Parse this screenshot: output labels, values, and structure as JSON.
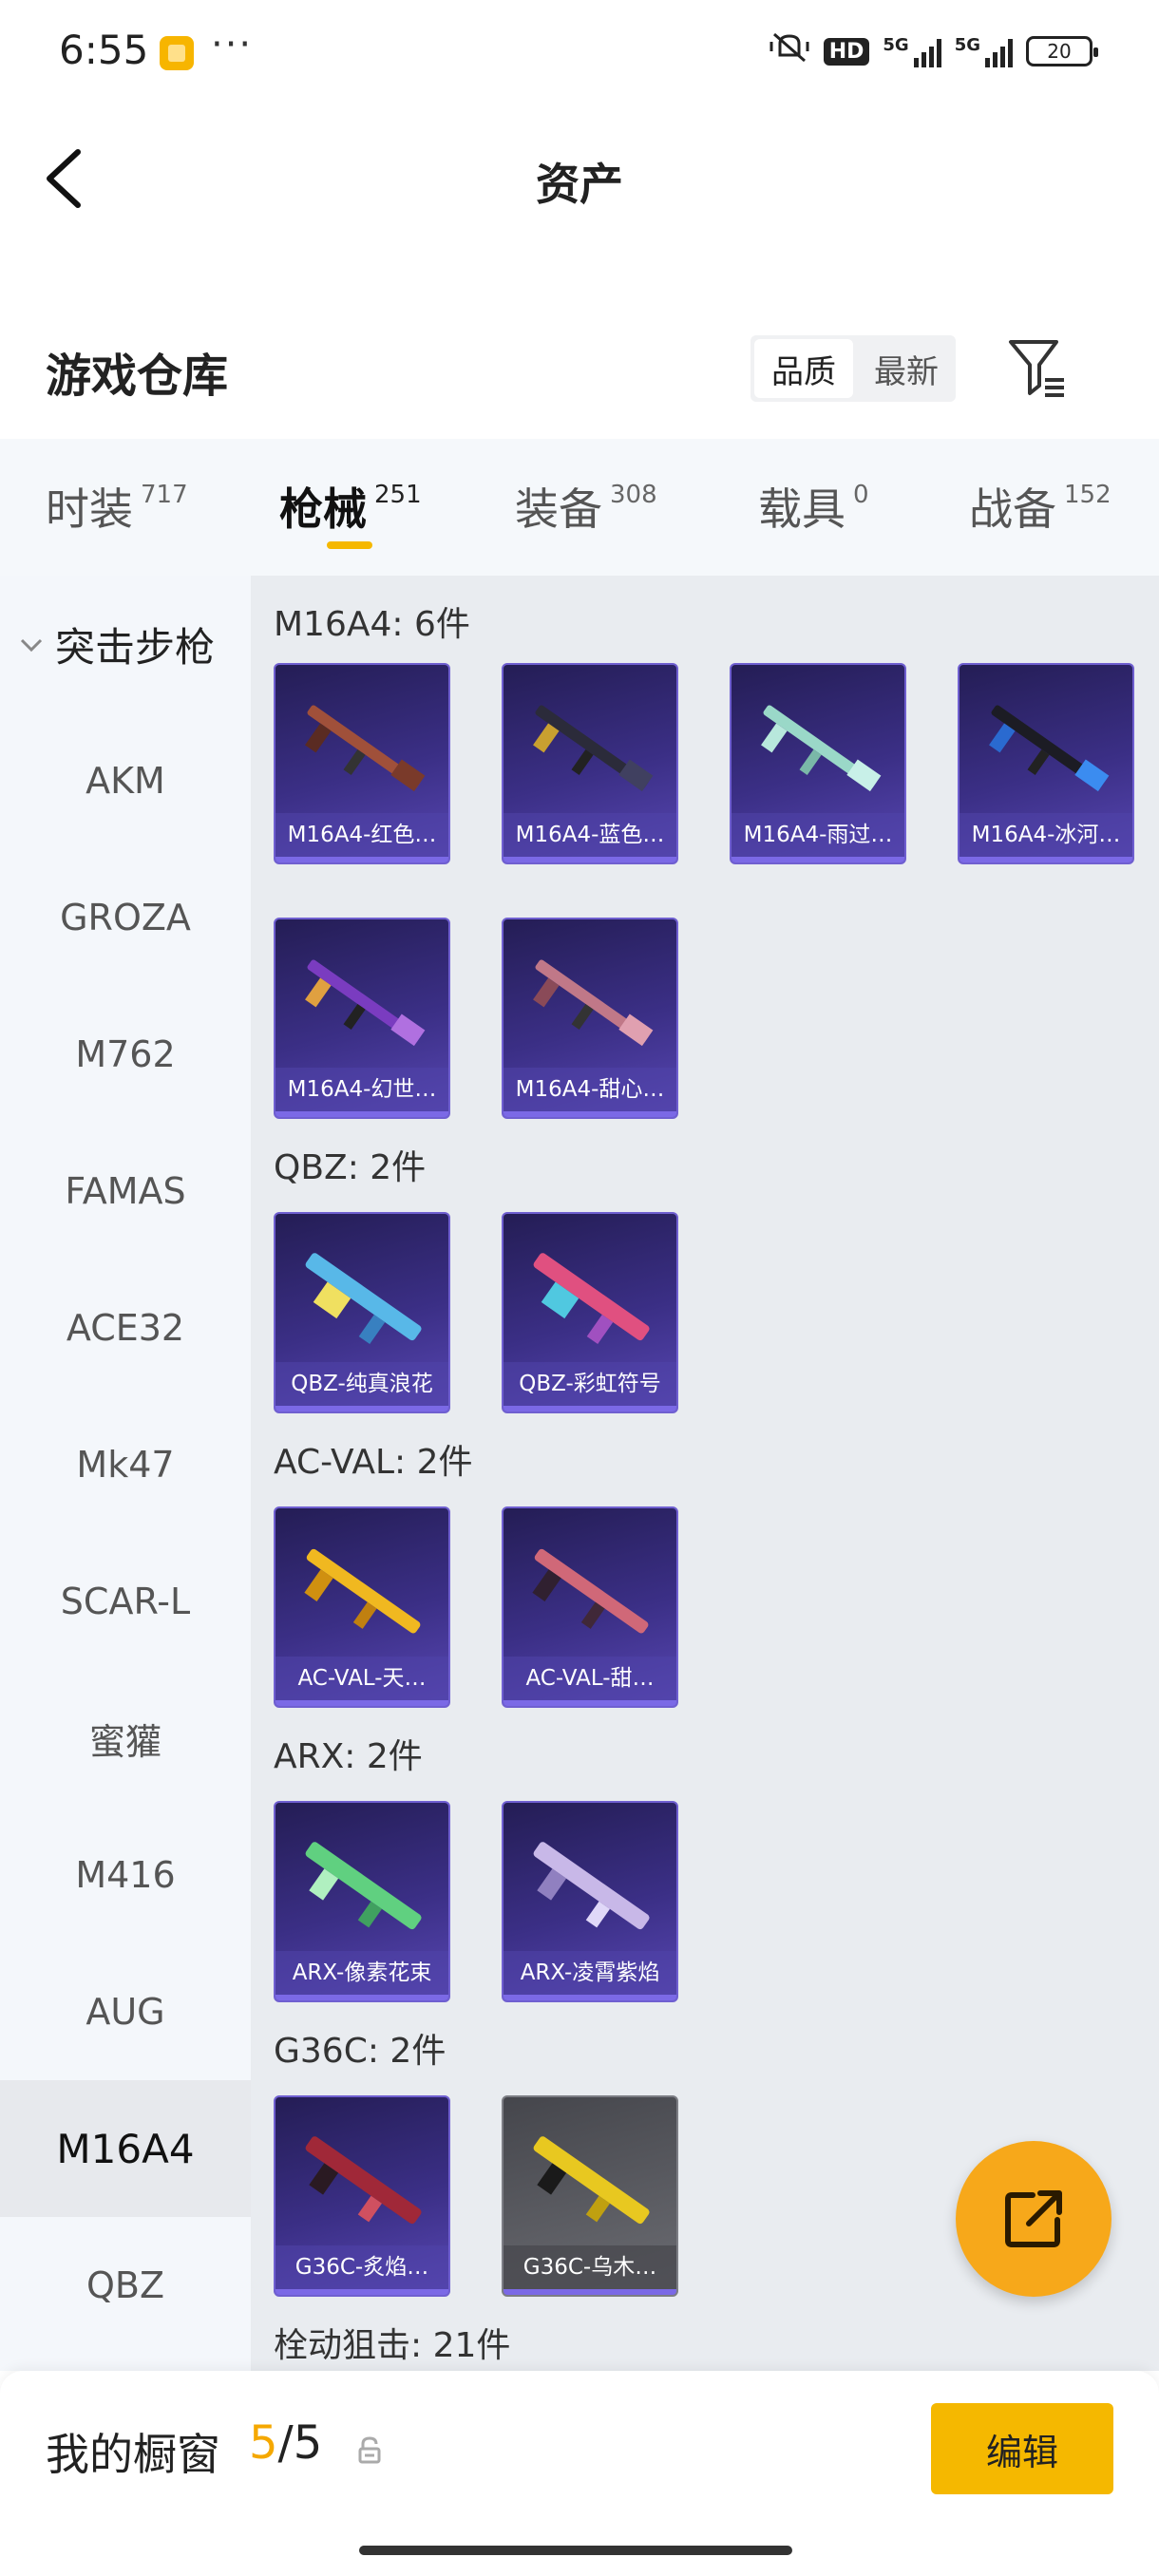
{
  "status_bar": {
    "time": "6:55",
    "more": "···",
    "hd": "HD",
    "net1": "5G",
    "net2": "5G",
    "battery": "20"
  },
  "header": {
    "title": "资产"
  },
  "section": {
    "title": "游戏仓库",
    "sort_quality": "品质",
    "sort_newest": "最新"
  },
  "tabs": [
    {
      "label": "时装",
      "count": "717"
    },
    {
      "label": "枪械",
      "count": "251"
    },
    {
      "label": "装备",
      "count": "308"
    },
    {
      "label": "载具",
      "count": "0"
    },
    {
      "label": "战备",
      "count": "152"
    }
  ],
  "sidebar": {
    "group": "突击步枪",
    "items": [
      "AKM",
      "GROZA",
      "M762",
      "FAMAS",
      "ACE32",
      "Mk47",
      "SCAR-L",
      "蜜獾",
      "M416",
      "AUG",
      "M16A4",
      "QBZ"
    ],
    "active": "M16A4"
  },
  "groups": [
    {
      "header": "M16A4: 6件",
      "items": [
        "M16A4-红色…",
        "M16A4-蓝色…",
        "M16A4-雨过…",
        "M16A4-冰河…",
        "M16A4-幻世…",
        "M16A4-甜心…"
      ]
    },
    {
      "header": "QBZ: 2件",
      "items": [
        "QBZ-纯真浪花",
        "QBZ-彩虹符号"
      ]
    },
    {
      "header": "AC-VAL: 2件",
      "items": [
        "AC-VAL-天…",
        "AC-VAL-甜…"
      ]
    },
    {
      "header": "ARX: 2件",
      "items": [
        "ARX-像素花束",
        "ARX-凌霄紫焰"
      ]
    },
    {
      "header": "G36C: 2件",
      "items": [
        "G36C-炙焰…",
        "G36C-乌木…"
      ]
    },
    {
      "header": "栓动狙击: 21件",
      "items": []
    }
  ],
  "bottom": {
    "label": "我的橱窗",
    "current": "5",
    "sep": "/",
    "total": "5",
    "edit": "编辑"
  },
  "colors": {
    "accent": "#f5b800",
    "card_purple": "#3b2f86",
    "fab": "#f7a81a"
  },
  "icons": [
    "back-arrow-icon",
    "filter-icon",
    "share-icon",
    "lock-icon",
    "chevron-down-icon"
  ]
}
